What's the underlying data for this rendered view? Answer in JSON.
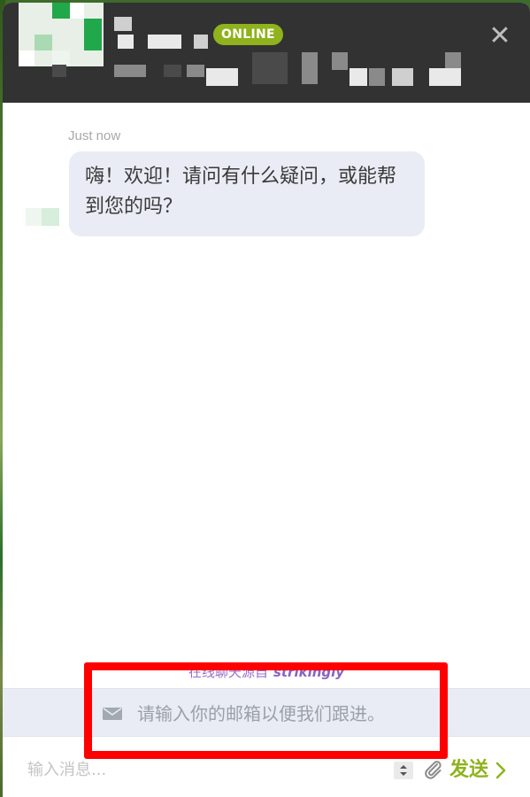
{
  "header": {
    "status_badge": "ONLINE",
    "close_glyph": "✕"
  },
  "conversation": {
    "timestamp": "Just now",
    "greeting": "嗨！欢迎！请问有什么疑问，或能帮到您的吗？"
  },
  "footer": {
    "powered_by": "在线聊天源自",
    "brand": "strikingly",
    "email_placeholder": "请输入你的邮箱以便我们跟进。",
    "message_placeholder": "输入消息...",
    "send_label": "发送"
  },
  "icons": {
    "mail": "mail-icon",
    "attach": "paperclip-icon",
    "send": "chevron-right-icon",
    "close": "close-icon"
  },
  "colors": {
    "header_bg": "#323232",
    "online_badge": "#8fb21d",
    "send": "#8fb21d",
    "bubble_bg": "#e9ecf4",
    "highlight": "#ff0000",
    "brand": "#8b62c4"
  }
}
